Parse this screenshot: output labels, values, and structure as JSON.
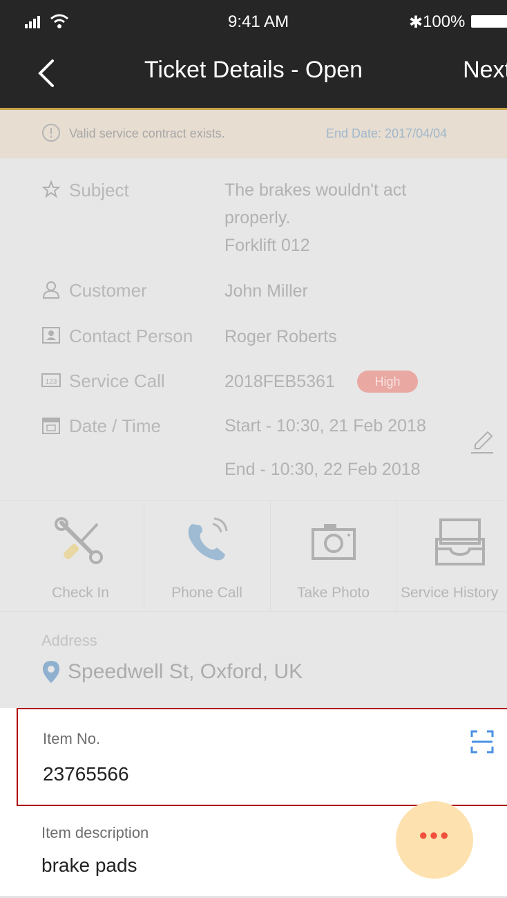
{
  "status_bar": {
    "time": "9:41 AM",
    "battery": "100%"
  },
  "nav": {
    "title": "Ticket Details - Open",
    "next_label": "Next",
    "back_icon": "chevron-left-icon"
  },
  "notice": {
    "text": "Valid service contract exists.",
    "end_date": "End Date: 2017/04/04"
  },
  "details": {
    "subject_label": "Subject",
    "subject_line1": "The brakes wouldn't act",
    "subject_line2": "properly.",
    "subject_line3": "Forklift 012",
    "customer_label": "Customer",
    "customer_value": "John Miller",
    "contact_label": "Contact Person",
    "contact_value": "Roger Roberts",
    "service_call_label": "Service Call",
    "service_call_value": "2018FEB5361",
    "priority": "High",
    "date_label": "Date / Time",
    "start": "Start - 10:30, 21 Feb 2018",
    "end": "End - 10:30, 22 Feb 2018"
  },
  "actions": [
    {
      "label": "Check In",
      "icon": "tools-icon"
    },
    {
      "label": "Phone Call",
      "icon": "phone-icon"
    },
    {
      "label": "Take Photo",
      "icon": "camera-icon"
    },
    {
      "label": "Service History",
      "icon": "inbox-icon"
    }
  ],
  "address": {
    "label": "Address",
    "value": "Speedwell St, Oxford, UK"
  },
  "item": {
    "label": "Item No.",
    "value": "23765566"
  },
  "description": {
    "label": "Item description",
    "value": "brake pads"
  },
  "colors": {
    "nav_bg": "#262626",
    "accent_gold": "#c9a24a",
    "highlight_border": "#b00000",
    "fab": "#fde1ae"
  }
}
